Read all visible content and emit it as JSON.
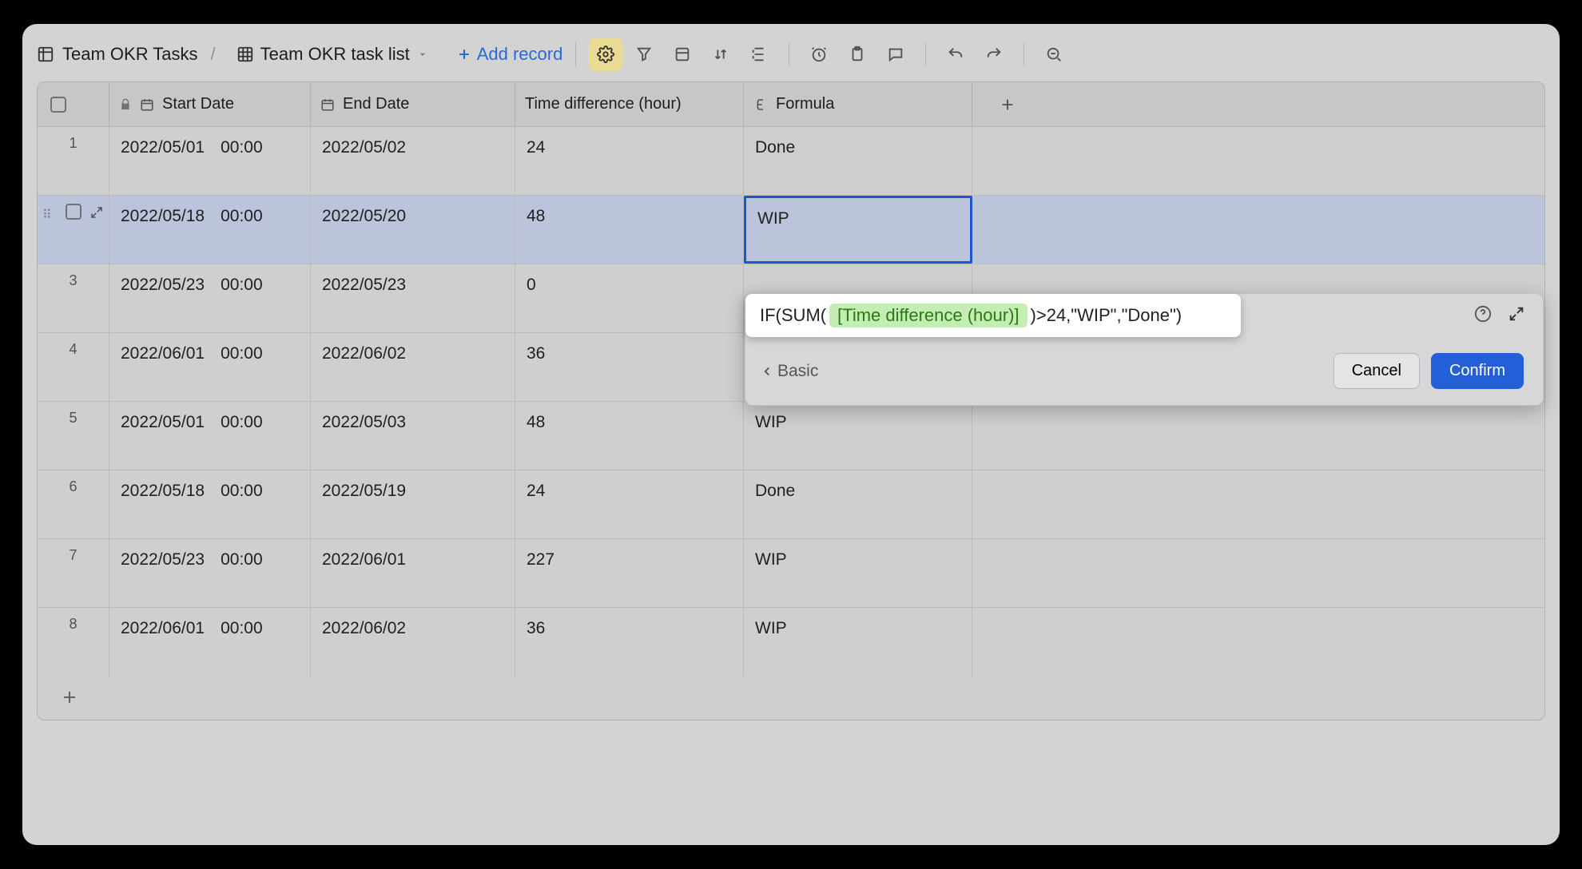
{
  "breadcrumb": {
    "workspace": "Team OKR Tasks",
    "view": "Team OKR task list"
  },
  "toolbar": {
    "add_record": "Add record"
  },
  "columns": {
    "start": "Start Date",
    "end": "End Date",
    "diff": "Time difference (hour)",
    "formula": "Formula"
  },
  "rows": [
    {
      "num": "1",
      "start_date": "2022/05/01",
      "start_time": "00:00",
      "end_date": "2022/05/02",
      "diff": "24",
      "formula": "Done"
    },
    {
      "num": "",
      "start_date": "2022/05/18",
      "start_time": "00:00",
      "end_date": "2022/05/20",
      "diff": "48",
      "formula": "WIP"
    },
    {
      "num": "3",
      "start_date": "2022/05/23",
      "start_time": "00:00",
      "end_date": "2022/05/23",
      "diff": "0",
      "formula": ""
    },
    {
      "num": "4",
      "start_date": "2022/06/01",
      "start_time": "00:00",
      "end_date": "2022/06/02",
      "diff": "36",
      "formula": ""
    },
    {
      "num": "5",
      "start_date": "2022/05/01",
      "start_time": "00:00",
      "end_date": "2022/05/03",
      "diff": "48",
      "formula": "WIP"
    },
    {
      "num": "6",
      "start_date": "2022/05/18",
      "start_time": "00:00",
      "end_date": "2022/05/19",
      "diff": "24",
      "formula": "Done"
    },
    {
      "num": "7",
      "start_date": "2022/05/23",
      "start_time": "00:00",
      "end_date": "2022/06/01",
      "diff": "227",
      "formula": "WIP"
    },
    {
      "num": "8",
      "start_date": "2022/06/01",
      "start_time": "00:00",
      "end_date": "2022/06/02",
      "diff": "36",
      "formula": "WIP"
    }
  ],
  "formula_editor": {
    "prefix": "IF(SUM(",
    "chip": "[Time difference (hour)]",
    "suffix": ")>24,\"WIP\",\"Done\")",
    "basic_label": "Basic",
    "cancel": "Cancel",
    "confirm": "Confirm"
  }
}
